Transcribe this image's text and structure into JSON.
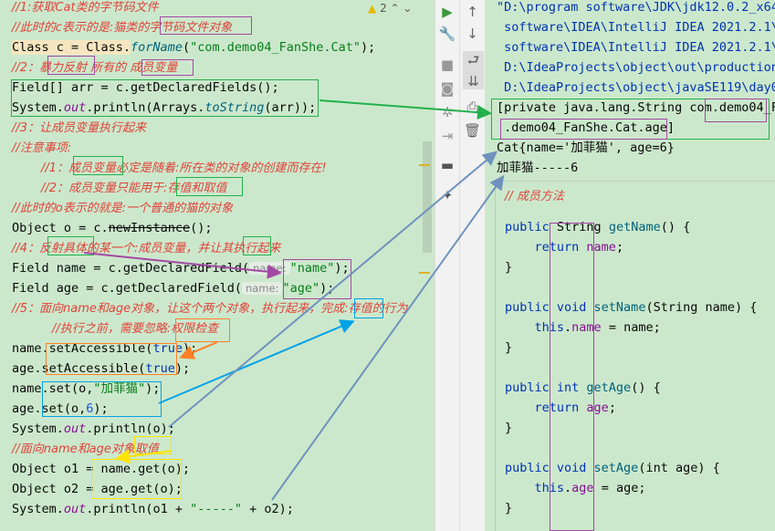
{
  "editor": {
    "warning_count": "2",
    "lines": [
      "//1:获取Cat类的字节码文件",
      "//此时的c表示的是:猫类的字节码文件对象",
      {
        "a": "Class c = Class.",
        "b": "forName",
        "c": "(",
        "d": "\"com.demo04_FanShe.Cat\"",
        "e": ");"
      },
      "//2：暴力反射 所有的 成员变量",
      "Field[] arr = c.getDeclaredFields();",
      {
        "a": "System.",
        "b": "out",
        "c": ".println(Arrays.",
        "d": "toString",
        "e": "(arr));"
      },
      "//3：让成员变量执行起来",
      "//注意事项:",
      "//1：成员变量必定是随着:所在类的对象的创建而存在!",
      "//2：成员变量只能用于:存值和取值",
      "//此时的o表示的就是:一个普通的猫的对象",
      {
        "a": "Object o = c.",
        "b": "newInstance",
        "c": "();"
      },
      "//4：反射具体的某一个:成员变量，并让其执行起来",
      {
        "a": "Field name = c.getDeclaredField(",
        "hint": "name:",
        "d": "\"name\"",
        "e": ");"
      },
      {
        "a": "Field age = c.getDeclaredField(",
        "hint": "name:",
        "d": "\"age\"",
        "e": ");"
      },
      "//5：面向name和age对象，让这个两个对象，执行起来，完成:存值的行为",
      "//执行之前，需要忽略:权限检查",
      {
        "a": "name.setAccessible(",
        "b": "true",
        "c": ");"
      },
      {
        "a": "age.setAccessible(",
        "b": "true",
        "c": ");"
      },
      {
        "a": "name.set(o,",
        "d": "\"加菲猫\"",
        "e": ");"
      },
      {
        "a": "age.set(o,",
        "b": "6",
        "c": ");"
      },
      {
        "a": "System.",
        "b": "out",
        "c": ".println(o);"
      },
      "//面向name和age对象取值",
      "Object o1 = name.get(o);",
      "Object o2 = age.get(o);",
      {
        "a": "System.",
        "b": "out",
        "c": ".println(o1 + ",
        "d": "\"-----\"",
        "e": " + o2);"
      }
    ]
  },
  "toolbar_icons": [
    "run-icon",
    "wrench-icon",
    "stop-icon",
    "camera-icon",
    "settings-icon",
    "login-icon",
    "layout-icon",
    "pin-icon"
  ],
  "console_toolbar_icons": [
    "up-arrow-icon",
    "down-arrow-icon",
    "soft-wrap-icon",
    "scroll-to-end-icon",
    "print-icon",
    "trash-icon"
  ],
  "console": {
    "lines": [
      "\"D:\\program software\\JDK\\jdk12.0.2_x64",
      " software\\IDEA\\IntelliJ IDEA 2021.2.1\\",
      " software\\IDEA\\IntelliJ IDEA 2021.2.1\\",
      " D:\\IdeaProjects\\object\\out\\production",
      " D:\\IdeaProjects\\object\\javaSE119\\day0",
      "[private java.lang.String com.demo04_F",
      " .demo04_FanShe.Cat.age]",
      "Cat{name='加菲猫', age=6}",
      "加菲猫-----6"
    ]
  },
  "popup": {
    "comment": "// 成员方法",
    "lines": [
      {
        "k": "public ",
        "t": "String ",
        "f": "getName",
        "r": "() {"
      },
      {
        "i": "    ",
        "k": "return ",
        "fl": "name",
        "r": ";"
      },
      {
        "r": "}"
      },
      {
        "k": "public void ",
        "f": "setName",
        "r": "(String name) {"
      },
      {
        "i": "    ",
        "k": "this",
        "r": ".",
        "fl": "name",
        "r2": " = name;"
      },
      {
        "r": "}"
      },
      {
        "k": "public int ",
        "f": "getAge",
        "r": "() {"
      },
      {
        "i": "    ",
        "k": "return ",
        "fl": "age",
        "r": ";"
      },
      {
        "r": "}"
      },
      {
        "k": "public void ",
        "f": "setAge",
        "r": "(int age) {"
      },
      {
        "i": "    ",
        "k": "this",
        "r": ".",
        "fl": "age",
        "r2": " = age;"
      },
      {
        "r": "}"
      }
    ]
  },
  "colors": {
    "background": "#cce8cc",
    "comment": "#e0433a",
    "string": "#067d17",
    "keyword": "#0033b3",
    "green_box": "#22b14c",
    "purple_box": "#a349a4",
    "orange_box": "#ff7f27",
    "blue_box": "#00a2e8",
    "yellow_box": "#ffe400",
    "arrow_grey_blue": "#7092be"
  }
}
